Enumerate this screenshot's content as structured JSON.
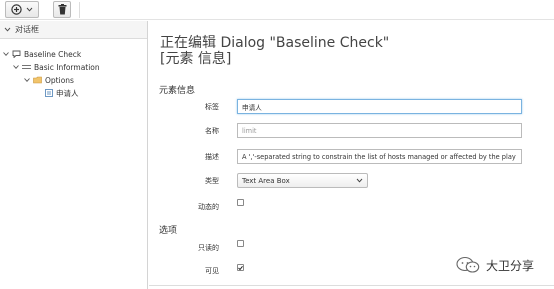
{
  "toolbar": {
    "add_menu_icon": "plus-circle-icon",
    "dropdown_icon": "chevron-down-icon",
    "delete_icon": "trash-icon"
  },
  "sidebar": {
    "title": "对话框",
    "tree": [
      {
        "label": "Baseline Check",
        "icon": "comment-icon"
      },
      {
        "label": "Basic Information",
        "icon": "section-icon"
      },
      {
        "label": "Options",
        "icon": "folder-icon"
      },
      {
        "label": "申请人",
        "icon": "field-icon"
      }
    ]
  },
  "main": {
    "title": "正在编辑 Dialog \"Baseline Check\" [元素 信息]",
    "section_element": "元素信息",
    "label_tag": "标签",
    "value_tag": "申请人",
    "label_name": "名称",
    "value_name": "limit",
    "label_desc": "描述",
    "value_desc": "A ','-separated string to constrain the list of hosts managed or affected by the play",
    "label_type": "类型",
    "value_type": "Text Area Box",
    "label_dynamic": "动态的",
    "section_options": "选项",
    "label_readonly": "只读的",
    "label_visible": "可见",
    "dynamic_checked": false,
    "readonly_checked": false,
    "visible_checked": true
  },
  "watermark": {
    "text": "大卫分享"
  }
}
